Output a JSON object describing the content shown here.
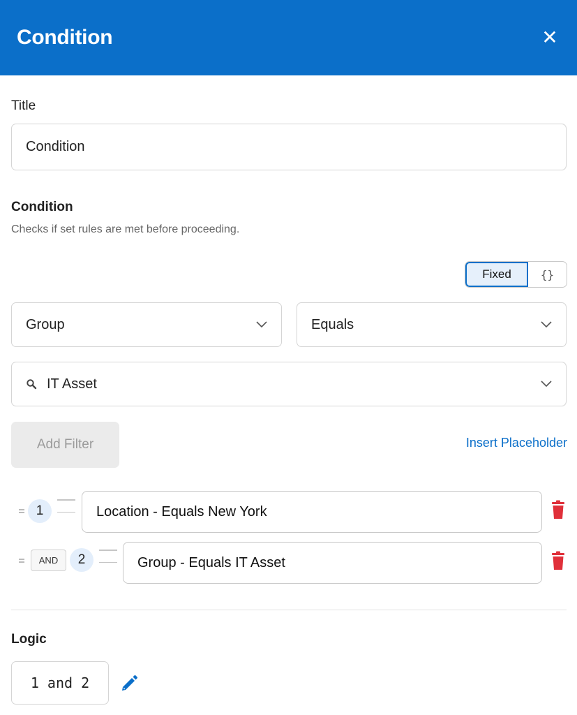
{
  "header": {
    "title": "Condition",
    "close_label": "✕"
  },
  "title_field": {
    "label": "Title",
    "value": "Condition"
  },
  "condition": {
    "heading": "Condition",
    "description": "Checks if set rules are met before proceeding.",
    "mode_toggle": {
      "fixed_label": "Fixed",
      "code_label": "{}"
    },
    "field_select": {
      "value": "Group"
    },
    "operator_select": {
      "value": "Equals"
    },
    "value_select": {
      "value": "IT Asset"
    },
    "add_filter_label": "Add Filter",
    "insert_placeholder_label": "Insert Placeholder",
    "filters": [
      {
        "index": "1",
        "text": "Location - Equals New York"
      },
      {
        "index": "2",
        "conjunction": "AND",
        "text": "Group - Equals IT Asset"
      }
    ]
  },
  "logic": {
    "heading": "Logic",
    "value": "1 and 2"
  },
  "colors": {
    "brand": "#0b6fc9",
    "danger": "#e0303a"
  }
}
